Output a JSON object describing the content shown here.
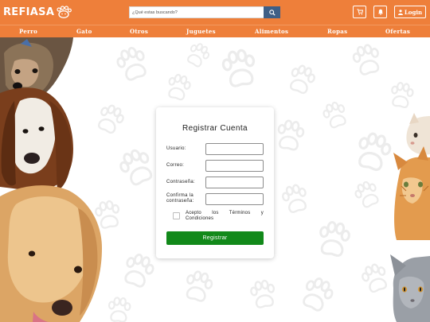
{
  "header": {
    "logo_text": "REFIASA",
    "search_placeholder": "¿Qué estas buscando?",
    "cart_icon": "cart-icon",
    "bell_icon": "bell-icon",
    "login_label": "Login"
  },
  "nav": {
    "items": [
      "Perro",
      "Gato",
      "Otros",
      "Juguetes",
      "Alimentos",
      "Ropas",
      "Ofertas"
    ]
  },
  "form": {
    "title": "Registrar Cuenta",
    "fields": [
      {
        "label": "Usuario:"
      },
      {
        "label": "Correo:"
      },
      {
        "label": "Contraseña:"
      },
      {
        "label": "Confirma la contraseña:"
      }
    ],
    "terms_label": "Acepto los Términos y Condiciones",
    "submit_label": "Registrar"
  },
  "colors": {
    "brand": "#ee7f3a",
    "search_button": "#3f5f86",
    "submit": "#12891a"
  }
}
